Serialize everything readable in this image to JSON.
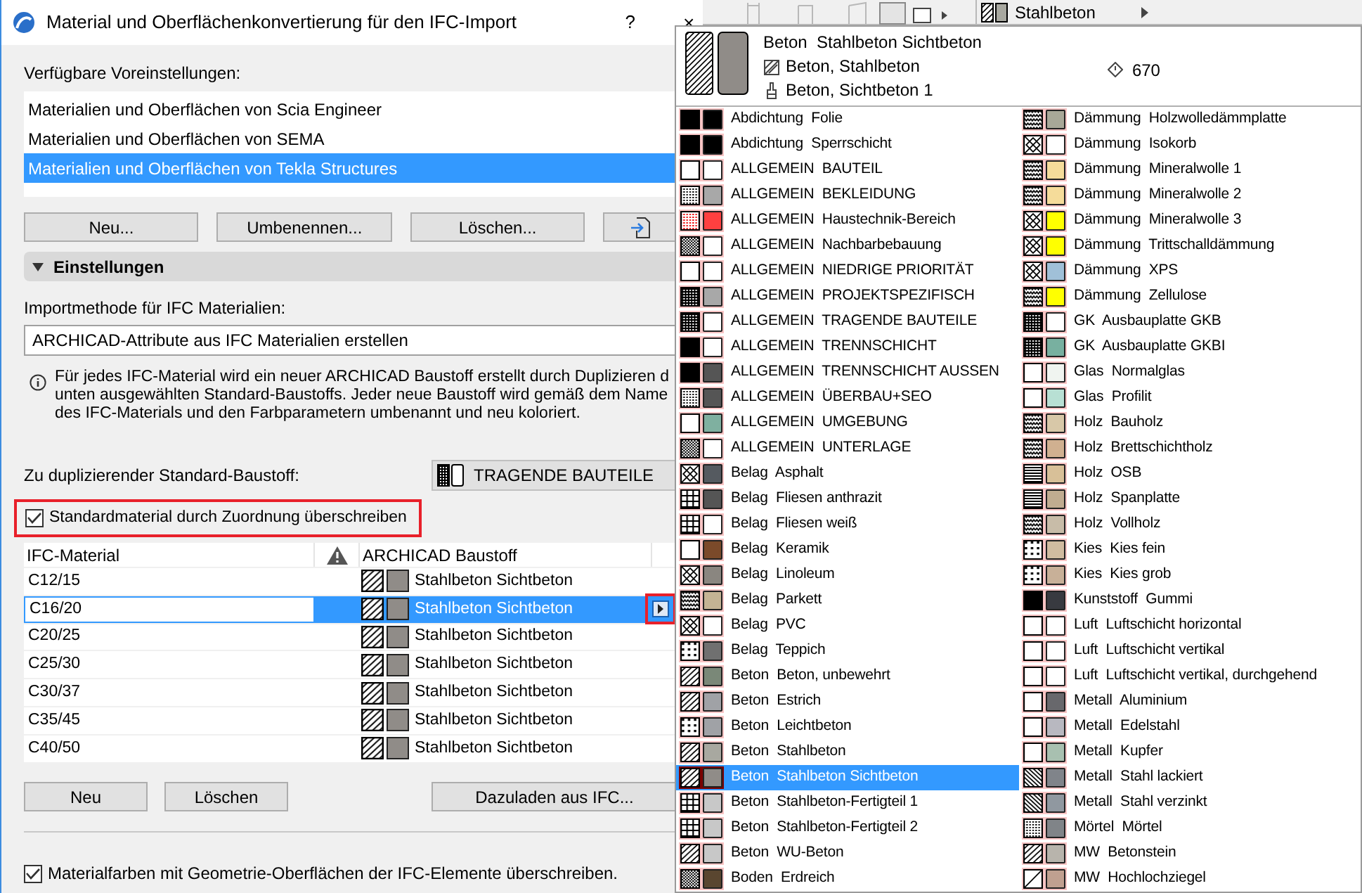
{
  "window": {
    "title": "Material und Oberflächenkonvertierung für den IFC-Import",
    "help": "?",
    "close": "×"
  },
  "presets": {
    "label": "Verfügbare Voreinstellungen:",
    "items": [
      {
        "label": "Materialien und Oberflächen von Scia Engineer",
        "selected": false
      },
      {
        "label": "Materialien und Oberflächen von SEMA",
        "selected": false
      },
      {
        "label": "Materialien und Oberflächen von Tekla Structures",
        "selected": true
      }
    ],
    "buttons": [
      "Neu...",
      "Umbenennen...",
      "Löschen..."
    ]
  },
  "settings": {
    "title": "Einstellungen",
    "expanded": true,
    "import_label": "Importmethode für IFC Materialien:",
    "import_value": "ARCHICAD-Attribute aus IFC Materialien erstellen",
    "info_lines": [
      "Für jedes IFC-Material wird ein neuer ARCHICAD Baustoff erstellt durch Duplizieren d",
      "unten ausgewählten Standard-Baustoffs. Jeder neue Baustoff wird gemäß dem Name",
      "des IFC-Materials und den Farbparametern umbenannt und neu koloriert."
    ],
    "default_label": "Zu duplizierender Standard-Baustoff:",
    "default_value": "TRAGENDE BAUTEILE",
    "override": {
      "label": "Standardmaterial durch Zuordnung überschreiben",
      "checked": true
    }
  },
  "table": {
    "columns": [
      "IFC-Material",
      "ARCHICAD Baustoff"
    ],
    "rows": [
      {
        "ifc": "C12/15",
        "material": "Stahlbeton Sichtbeton",
        "selected": false
      },
      {
        "ifc": "C16/20",
        "material": "Stahlbeton Sichtbeton",
        "selected": true
      },
      {
        "ifc": "C20/25",
        "material": "Stahlbeton Sichtbeton",
        "selected": false
      },
      {
        "ifc": "C25/30",
        "material": "Stahlbeton Sichtbeton",
        "selected": false
      },
      {
        "ifc": "C30/37",
        "material": "Stahlbeton Sichtbeton",
        "selected": false
      },
      {
        "ifc": "C35/45",
        "material": "Stahlbeton Sichtbeton",
        "selected": false
      },
      {
        "ifc": "C40/50",
        "material": "Stahlbeton Sichtbeton",
        "selected": false
      }
    ],
    "buttons": [
      "Neu",
      "Löschen",
      "Dazuladen aus IFC..."
    ]
  },
  "footer": {
    "label": "Materialfarben mit Geometrie-Oberflächen der IFC-Elemente überschreiben.",
    "checked": true
  },
  "toolbar": {
    "material": "Stahlbeton"
  },
  "popup": {
    "title": "Beton  Stahlbeton Sichtbeton",
    "cut_fill": "Beton, Stahlbeton",
    "surface": "Beton, Sichtbeton 1",
    "index": "670",
    "kind": "hatch",
    "color": "#908c88",
    "columns": [
      [
        {
          "label": "Abdichtung  Folie",
          "kind": "solid",
          "color": "#000000",
          "selected": false
        },
        {
          "label": "Abdichtung  Sperrschicht",
          "kind": "solid",
          "color": "#000000",
          "selected": false
        },
        {
          "label": "ALLGEMEIN  BAUTEIL",
          "kind": "empty",
          "color": "#ffffff",
          "selected": false
        },
        {
          "label": "ALLGEMEIN  BEKLEIDUNG",
          "kind": "dots",
          "color": "#a8a8a8",
          "selected": false
        },
        {
          "label": "ALLGEMEIN  Haustechnik-Bereich",
          "kind": "reddots",
          "color": "#ff4040",
          "selected": false
        },
        {
          "label": "ALLGEMEIN  Nachbarbebauung",
          "kind": "checker",
          "color": "#ffffff",
          "selected": false
        },
        {
          "label": "ALLGEMEIN  NIEDRIGE PRIORITÄT",
          "kind": "empty",
          "color": "#ffffff",
          "selected": false
        },
        {
          "label": "ALLGEMEIN  PROJEKTSPEZIFISCH",
          "kind": "dense",
          "color": "#a8a8a8",
          "selected": false
        },
        {
          "label": "ALLGEMEIN  TRAGENDE BAUTEILE",
          "kind": "dense",
          "color": "#ffffff",
          "selected": false
        },
        {
          "label": "ALLGEMEIN  TRENNSCHICHT",
          "kind": "solid",
          "color": "#ffffff",
          "selected": false
        },
        {
          "label": "ALLGEMEIN  TRENNSCHICHT AUSSEN",
          "kind": "solid",
          "color": "#555555",
          "selected": false
        },
        {
          "label": "ALLGEMEIN  ÜBERBAU+SEO",
          "kind": "dots",
          "color": "#555555",
          "selected": false
        },
        {
          "label": "ALLGEMEIN  UMGEBUNG",
          "kind": "empty",
          "color": "#7fb0a0",
          "selected": false
        },
        {
          "label": "ALLGEMEIN  UNTERLAGE",
          "kind": "checker",
          "color": "#ffffff",
          "selected": false
        },
        {
          "label": "Belag  Asphalt",
          "kind": "cross",
          "color": "#555a60",
          "selected": false
        },
        {
          "label": "Belag  Fliesen anthrazit",
          "kind": "grid",
          "color": "#555555",
          "selected": false
        },
        {
          "label": "Belag  Fliesen weiß",
          "kind": "grid",
          "color": "#ffffff",
          "selected": false
        },
        {
          "label": "Belag  Keramik",
          "kind": "empty",
          "color": "#7b4a2a",
          "selected": false
        },
        {
          "label": "Belag  Linoleum",
          "kind": "cross",
          "color": "#8a8680",
          "selected": false
        },
        {
          "label": "Belag  Parkett",
          "kind": "wave",
          "color": "#c4b494",
          "selected": false
        },
        {
          "label": "Belag  PVC",
          "kind": "cross",
          "color": "#ffffff",
          "selected": false
        },
        {
          "label": "Belag  Teppich",
          "kind": "spots",
          "color": "#707070",
          "selected": false
        },
        {
          "label": "Beton  Beton, unbewehrt",
          "kind": "hatch",
          "color": "#7a8878",
          "selected": false
        },
        {
          "label": "Beton  Estrich",
          "kind": "hatch",
          "color": "#a0a2a6",
          "selected": false
        },
        {
          "label": "Beton  Leichtbeton",
          "kind": "spots",
          "color": "#a0a2a6",
          "selected": false
        },
        {
          "label": "Beton  Stahlbeton",
          "kind": "hatch",
          "color": "#a8a8a0",
          "selected": false
        },
        {
          "label": "Beton  Stahlbeton Sichtbeton",
          "kind": "hatch",
          "color": "#908c88",
          "selected": true
        },
        {
          "label": "Beton  Stahlbeton-Fertigteil 1",
          "kind": "grid",
          "color": "#c8c8c8",
          "selected": false
        },
        {
          "label": "Beton  Stahlbeton-Fertigteil 2",
          "kind": "grid",
          "color": "#c8c8c8",
          "selected": false
        },
        {
          "label": "Beton  WU-Beton",
          "kind": "hatch",
          "color": "#c8c8c8",
          "selected": false
        },
        {
          "label": "Boden  Erdreich",
          "kind": "checker",
          "color": "#5a4630",
          "selected": false
        }
      ],
      [
        {
          "label": "Dämmung  Holzwolledämmplatte",
          "kind": "wave",
          "color": "#a8a898",
          "selected": false
        },
        {
          "label": "Dämmung  Isokorb",
          "kind": "cross",
          "color": "#ffffff",
          "selected": false
        },
        {
          "label": "Dämmung  Mineralwolle 1",
          "kind": "wave",
          "color": "#f5dc9a",
          "selected": false
        },
        {
          "label": "Dämmung  Mineralwolle 2",
          "kind": "wave",
          "color": "#f5dc9a",
          "selected": false
        },
        {
          "label": "Dämmung  Mineralwolle 3",
          "kind": "cross",
          "color": "#ffff00",
          "selected": false
        },
        {
          "label": "Dämmung  Trittschalldämmung",
          "kind": "cross",
          "color": "#ffff00",
          "selected": false
        },
        {
          "label": "Dämmung  XPS",
          "kind": "cross",
          "color": "#a0c0d8",
          "selected": false
        },
        {
          "label": "Dämmung  Zellulose",
          "kind": "wave",
          "color": "#ffff00",
          "selected": false
        },
        {
          "label": "GK  Ausbauplatte GKB",
          "kind": "dense",
          "color": "#ffffff",
          "selected": false
        },
        {
          "label": "GK  Ausbauplatte GKBI",
          "kind": "dense",
          "color": "#78b0a0",
          "selected": false
        },
        {
          "label": "Glas  Normalglas",
          "kind": "empty",
          "color": "#f0f4f0",
          "selected": false
        },
        {
          "label": "Glas  Profilit",
          "kind": "empty",
          "color": "#b8e0d4",
          "selected": false
        },
        {
          "label": "Holz  Bauholz",
          "kind": "wave",
          "color": "#d8c8a8",
          "selected": false
        },
        {
          "label": "Holz  Brettschichtholz",
          "kind": "wave",
          "color": "#d0b090",
          "selected": false
        },
        {
          "label": "Holz  OSB",
          "kind": "lines",
          "color": "#d8c098",
          "selected": false
        },
        {
          "label": "Holz  Spanplatte",
          "kind": "lines",
          "color": "#c0ac90",
          "selected": false
        },
        {
          "label": "Holz  Vollholz",
          "kind": "wave",
          "color": "#c8bca8",
          "selected": false
        },
        {
          "label": "Kies  Kies fein",
          "kind": "spots",
          "color": "#d0bca0",
          "selected": false
        },
        {
          "label": "Kies  Kies grob",
          "kind": "spots",
          "color": "#c8b098",
          "selected": false
        },
        {
          "label": "Kunststoff  Gummi",
          "kind": "solid",
          "color": "#383a40",
          "selected": false
        },
        {
          "label": "Luft  Luftschicht horizontal",
          "kind": "empty",
          "color": "#ffffff",
          "selected": false
        },
        {
          "label": "Luft  Luftschicht vertikal",
          "kind": "empty",
          "color": "#ffffff",
          "selected": false
        },
        {
          "label": "Luft  Luftschicht vertikal, durchgehend",
          "kind": "empty",
          "color": "#ffffff",
          "selected": false
        },
        {
          "label": "Metall  Aluminium",
          "kind": "empty",
          "color": "#68686c",
          "selected": false
        },
        {
          "label": "Metall  Edelstahl",
          "kind": "empty",
          "color": "#b8b8c0",
          "selected": false
        },
        {
          "label": "Metall  Kupfer",
          "kind": "empty",
          "color": "#a8c0b0",
          "selected": false
        },
        {
          "label": "Metall  Stahl lackiert",
          "kind": "backhatch",
          "color": "#80848a",
          "selected": false
        },
        {
          "label": "Metall  Stahl verzinkt",
          "kind": "backhatch",
          "color": "#9098a0",
          "selected": false
        },
        {
          "label": "Mörtel  Mörtel",
          "kind": "dots",
          "color": "#808488",
          "selected": false
        },
        {
          "label": "MW  Betonstein",
          "kind": "hatch",
          "color": "#b8b4ac",
          "selected": false
        },
        {
          "label": "MW  Hochlochziegel",
          "kind": "diag",
          "color": "#c0a090",
          "selected": false
        }
      ]
    ]
  }
}
